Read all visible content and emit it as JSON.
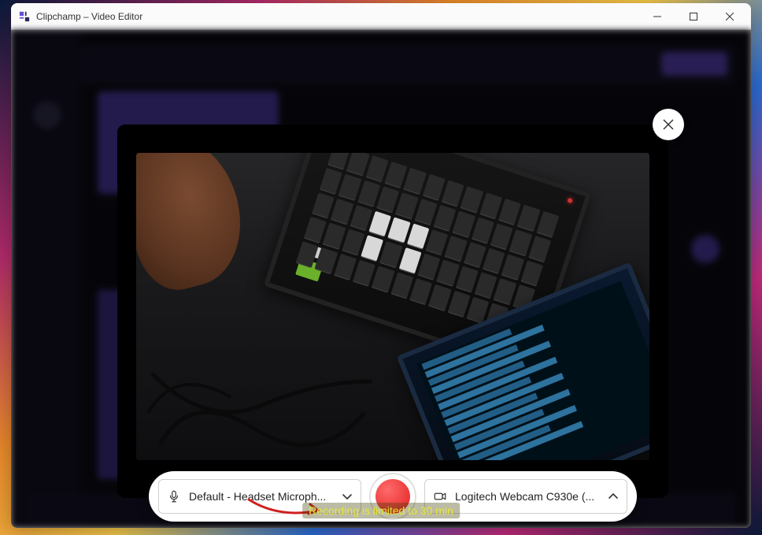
{
  "window": {
    "title": "Clipchamp – Video Editor"
  },
  "controls": {
    "mic": {
      "label": "Default - Headset Microph..."
    },
    "camera": {
      "label": "Logitech Webcam C930e (..."
    }
  },
  "notice": {
    "recording_limit": "Recording is limited to 30 min"
  }
}
